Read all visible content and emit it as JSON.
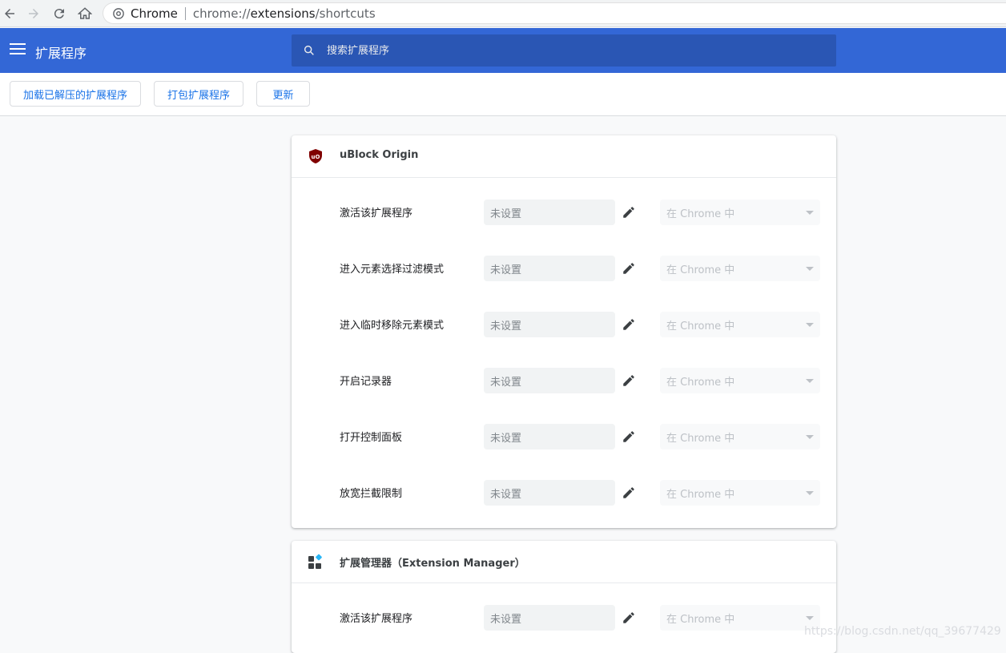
{
  "browser": {
    "site_label": "Chrome",
    "url_scheme": "chrome://",
    "url_host": "extensions",
    "url_path": "/shortcuts"
  },
  "header": {
    "title": "扩展程序",
    "search_placeholder": "搜索扩展程序"
  },
  "toolbar": {
    "load_unpacked": "加载已解压的扩展程序",
    "pack": "打包扩展程序",
    "update": "更新"
  },
  "extensions": [
    {
      "name": "uBlock Origin",
      "commands": [
        {
          "label": "激活该扩展程序",
          "shortcut": "未设置",
          "scope": "在 Chrome 中"
        },
        {
          "label": "进入元素选择过滤模式",
          "shortcut": "未设置",
          "scope": "在 Chrome 中"
        },
        {
          "label": "进入临时移除元素模式",
          "shortcut": "未设置",
          "scope": "在 Chrome 中"
        },
        {
          "label": "开启记录器",
          "shortcut": "未设置",
          "scope": "在 Chrome 中"
        },
        {
          "label": "打开控制面板",
          "shortcut": "未设置",
          "scope": "在 Chrome 中"
        },
        {
          "label": "放宽拦截限制",
          "shortcut": "未设置",
          "scope": "在 Chrome 中"
        }
      ]
    },
    {
      "name": "扩展管理器（Extension Manager）",
      "commands": [
        {
          "label": "激活该扩展程序",
          "shortcut": "未设置",
          "scope": "在 Chrome 中"
        }
      ]
    }
  ],
  "watermark": "https://blog.csdn.net/qq_39677429",
  "colors": {
    "header_bg": "#3367d6",
    "accent": "#1a73e8"
  }
}
